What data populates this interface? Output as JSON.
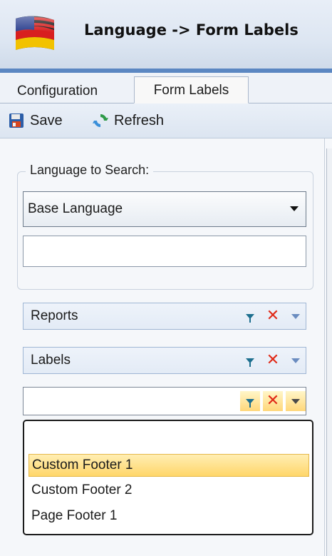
{
  "header": {
    "title": "Language -> Form Labels",
    "flag_icon": "flag-usa-germany-icon"
  },
  "tabs": [
    {
      "label": "Configuration",
      "active": false
    },
    {
      "label": "Form Labels",
      "active": true
    }
  ],
  "toolbar": {
    "save_label": "Save",
    "refresh_label": "Refresh"
  },
  "search": {
    "group_label": "Language to Search:",
    "language_selected": "Base Language",
    "text_value": ""
  },
  "filters": [
    {
      "label": "Reports"
    },
    {
      "label": "Labels"
    }
  ],
  "label_filter": {
    "value": ""
  },
  "dropdown_options": [
    {
      "label": "",
      "selected": false
    },
    {
      "label": "Custom Footer 1",
      "selected": true
    },
    {
      "label": "Custom Footer 2",
      "selected": false
    },
    {
      "label": "Page Footer 1",
      "selected": false
    }
  ],
  "colors": {
    "accent": "#5b87c2",
    "selection": "#ffd66a",
    "delete": "#e02a18"
  }
}
